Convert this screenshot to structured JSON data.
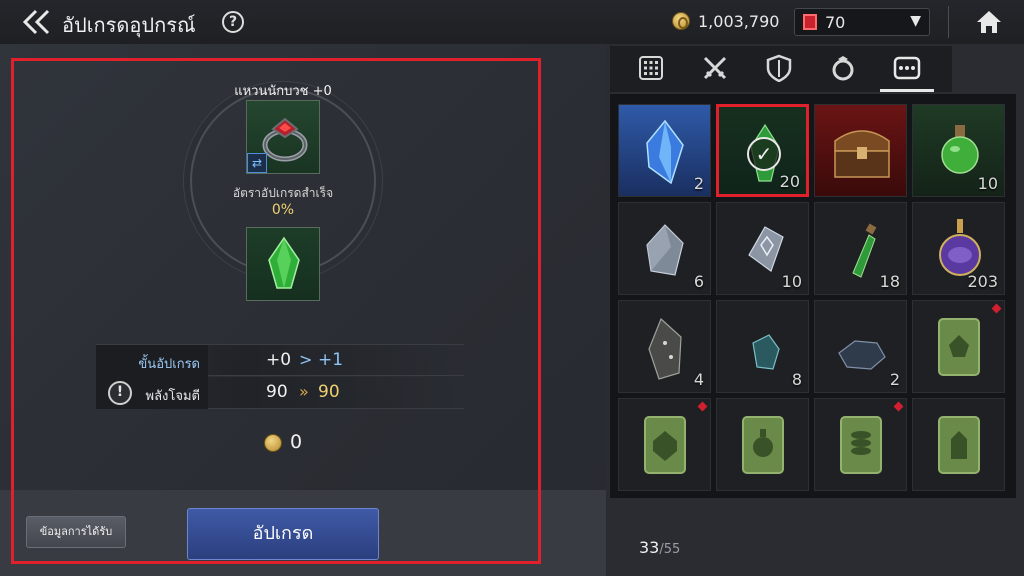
{
  "header": {
    "title": "อัปเกรดอุปกรณ์",
    "help_glyph": "?",
    "gold_amount": "1,003,790",
    "gem_amount": "70"
  },
  "upgrade_panel": {
    "item_name": "แหวนนักบวช +0",
    "success_rate_label": "อัตราอัปเกรดสำเร็จ",
    "success_rate_value": "0%",
    "stats": [
      {
        "label": "ขั้นอัปเกรด",
        "from": "+0",
        "arrow": ">",
        "to": "+1"
      },
      {
        "label": "พลังโจมตี",
        "from": "90",
        "arrow": "»",
        "to": "90"
      }
    ],
    "cost_value": "0",
    "info_button": "ข้อมูลการได้รับ",
    "upgrade_button": "อัปเกรด"
  },
  "inventory": {
    "tabs": [
      {
        "icon": "grid-icon",
        "active": false
      },
      {
        "icon": "crossed-swords-icon",
        "active": false
      },
      {
        "icon": "shield-icon",
        "active": false
      },
      {
        "icon": "ring-icon",
        "active": false
      },
      {
        "icon": "more-icon",
        "active": true
      }
    ],
    "items": [
      {
        "icon": "blue-crystal-icon",
        "qty": "2",
        "selected": false,
        "new": false
      },
      {
        "icon": "green-gem-icon",
        "qty": "20",
        "selected": true,
        "new": false
      },
      {
        "icon": "treasure-chest-icon",
        "qty": "",
        "selected": false,
        "new": false
      },
      {
        "icon": "green-potion-icon",
        "qty": "10",
        "selected": false,
        "new": false
      },
      {
        "icon": "grey-stone-icon",
        "qty": "6",
        "selected": false,
        "new": false
      },
      {
        "icon": "rune-stone-icon",
        "qty": "10",
        "selected": false,
        "new": false
      },
      {
        "icon": "green-vial-icon",
        "qty": "18",
        "selected": false,
        "new": false
      },
      {
        "icon": "purple-flask-icon",
        "qty": "203",
        "selected": false,
        "new": false
      },
      {
        "icon": "dark-ore-icon",
        "qty": "4",
        "selected": false,
        "new": false
      },
      {
        "icon": "teal-ore-icon",
        "qty": "8",
        "selected": false,
        "new": false
      },
      {
        "icon": "coal-icon",
        "qty": "2",
        "selected": false,
        "new": false
      },
      {
        "icon": "card-guild-icon",
        "qty": "",
        "selected": false,
        "new": true
      },
      {
        "icon": "card-shield-icon",
        "qty": "",
        "selected": false,
        "new": true
      },
      {
        "icon": "card-potion-icon",
        "qty": "",
        "selected": false,
        "new": false
      },
      {
        "icon": "card-coins-icon",
        "qty": "",
        "selected": false,
        "new": true
      },
      {
        "icon": "card-tower-icon",
        "qty": "",
        "selected": false,
        "new": false
      }
    ],
    "capacity_used": "33",
    "capacity_max": "/55"
  },
  "colors": {
    "selection": "#e0202b",
    "accent_blue": "#8fc4f5",
    "gold": "#f0d070"
  }
}
